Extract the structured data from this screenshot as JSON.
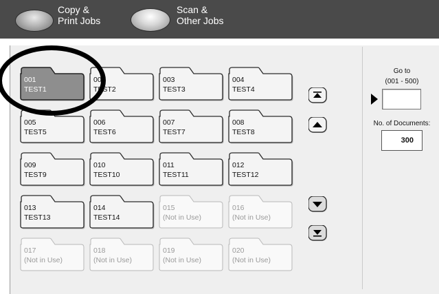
{
  "tabs": [
    {
      "line1": "Copy &",
      "line2": "Print Jobs"
    },
    {
      "line1": "Scan &",
      "line2": "Other Jobs"
    }
  ],
  "folders": [
    {
      "number": "001",
      "name": "TEST1",
      "state": "selected"
    },
    {
      "number": "002",
      "name": "TEST2",
      "state": "used"
    },
    {
      "number": "003",
      "name": "TEST3",
      "state": "used"
    },
    {
      "number": "004",
      "name": "TEST4",
      "state": "used"
    },
    {
      "number": "005",
      "name": "TEST5",
      "state": "used"
    },
    {
      "number": "006",
      "name": "TEST6",
      "state": "used"
    },
    {
      "number": "007",
      "name": "TEST7",
      "state": "used"
    },
    {
      "number": "008",
      "name": "TEST8",
      "state": "used"
    },
    {
      "number": "009",
      "name": "TEST9",
      "state": "used"
    },
    {
      "number": "010",
      "name": "TEST10",
      "state": "used"
    },
    {
      "number": "011",
      "name": "TEST11",
      "state": "used"
    },
    {
      "number": "012",
      "name": "TEST12",
      "state": "used"
    },
    {
      "number": "013",
      "name": "TEST13",
      "state": "used"
    },
    {
      "number": "014",
      "name": "TEST14",
      "state": "used"
    },
    {
      "number": "015",
      "name": "(Not in Use)",
      "state": "unused"
    },
    {
      "number": "016",
      "name": "(Not in Use)",
      "state": "unused"
    },
    {
      "number": "017",
      "name": "(Not in Use)",
      "state": "unused"
    },
    {
      "number": "018",
      "name": "(Not in Use)",
      "state": "unused"
    },
    {
      "number": "019",
      "name": "(Not in Use)",
      "state": "unused"
    },
    {
      "number": "020",
      "name": "(Not in Use)",
      "state": "unused"
    }
  ],
  "scroll_buttons": [
    "scroll-to-top-icon",
    "scroll-up-icon",
    "scroll-down-icon",
    "scroll-to-bottom-icon"
  ],
  "goto": {
    "label_line1": "Go to",
    "label_line2": "(001 - 500)",
    "value": ""
  },
  "documents": {
    "label": "No. of Documents:",
    "value": "300"
  },
  "colors": {
    "topbar": "#4a4a4a",
    "panel": "#efefef",
    "folder_used": "#f4f4f4",
    "folder_selected": "#8e8e8e",
    "folder_unused": "#f9f9f9",
    "annotation": "#000000"
  }
}
